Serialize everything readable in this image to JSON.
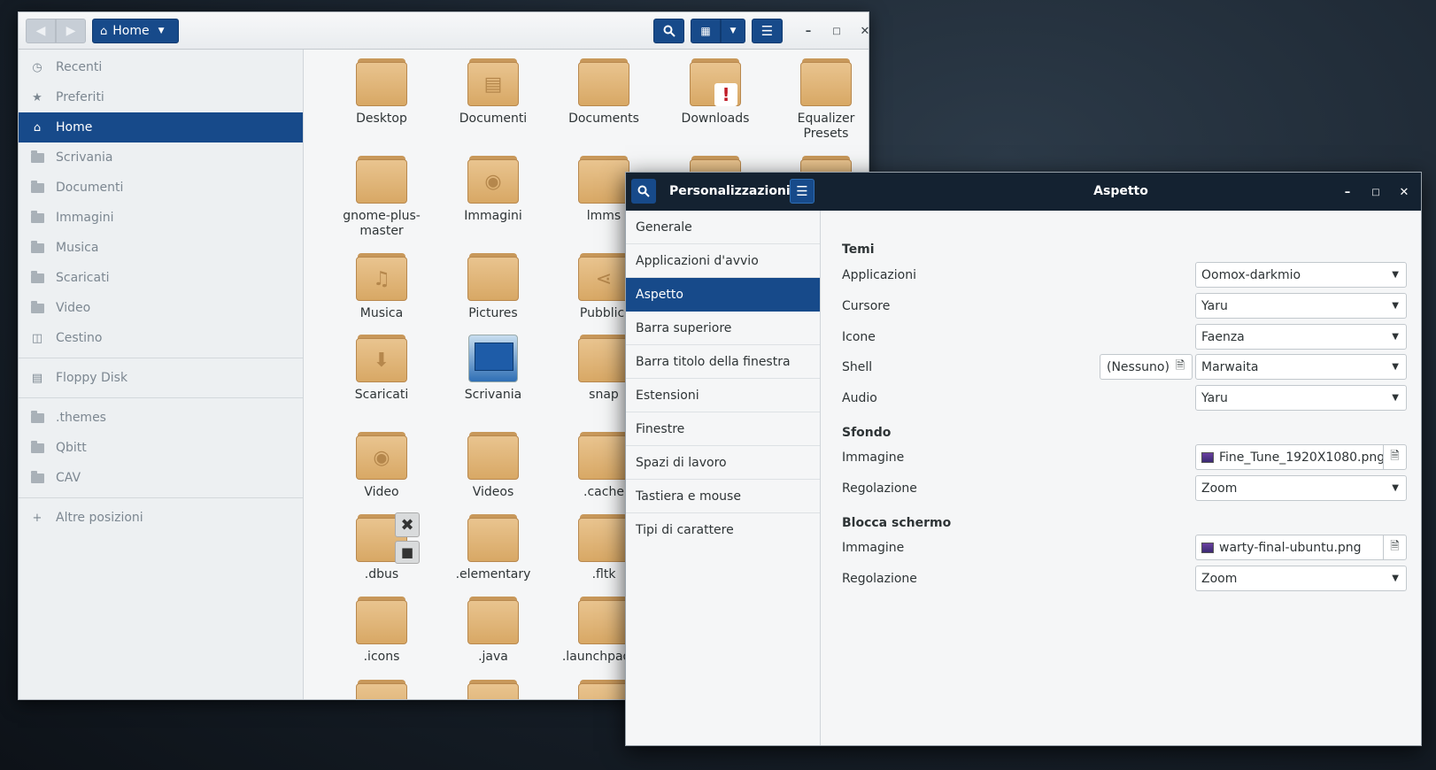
{
  "file_manager": {
    "location": "Home",
    "sidebar": [
      {
        "label": "Recenti",
        "icon": "clock-icon"
      },
      {
        "label": "Preferiti",
        "icon": "star-icon"
      },
      {
        "label": "Home",
        "icon": "home-icon",
        "active": true
      },
      {
        "label": "Scrivania",
        "icon": "folder-icon"
      },
      {
        "label": "Documenti",
        "icon": "folder-icon"
      },
      {
        "label": "Immagini",
        "icon": "folder-icon"
      },
      {
        "label": "Musica",
        "icon": "folder-icon"
      },
      {
        "label": "Scaricati",
        "icon": "folder-icon"
      },
      {
        "label": "Video",
        "icon": "folder-icon"
      },
      {
        "label": "Cestino",
        "icon": "trash-icon"
      },
      {
        "label": "Floppy Disk",
        "icon": "drive-icon"
      },
      {
        "label": ".themes",
        "icon": "folder-icon"
      },
      {
        "label": "Qbitt",
        "icon": "folder-icon"
      },
      {
        "label": "CAV",
        "icon": "folder-icon"
      },
      {
        "label": "Altre posizioni",
        "icon": "plus-icon"
      }
    ],
    "items": [
      {
        "label": "Desktop"
      },
      {
        "label": "Documenti",
        "emblem": "document-icon"
      },
      {
        "label": "Documents"
      },
      {
        "label": "Downloads",
        "badge": "warning-icon"
      },
      {
        "label": "Equalizer Presets"
      },
      {
        "label": "gnome-plus-master"
      },
      {
        "label": "Immagini",
        "emblem": "camera-icon"
      },
      {
        "label": "lmms"
      },
      {
        "label": "Musica",
        "emblem": "music-note-icon"
      },
      {
        "label": "Pictures"
      },
      {
        "label": "Pubblici",
        "emblem": "share-icon"
      },
      {
        "label": "Scaricati",
        "emblem": "download-arrow-icon"
      },
      {
        "label": "Scrivania",
        "special": "desktop-app-icon"
      },
      {
        "label": "snap"
      },
      {
        "label": "Video",
        "emblem": "film-camera-icon"
      },
      {
        "label": "Videos"
      },
      {
        "label": ".cache"
      },
      {
        "label": ".dbus",
        "badge": "no-access-lock-icon"
      },
      {
        "label": ".elementary"
      },
      {
        "label": ".fltk"
      },
      {
        "label": ".icons"
      },
      {
        "label": ".java"
      },
      {
        "label": ".launchpadlib"
      }
    ]
  },
  "tweaks": {
    "sidebar_title": "Personalizzazioni",
    "title": "Aspetto",
    "sidebar": [
      {
        "label": "Generale"
      },
      {
        "label": "Applicazioni d'avvio"
      },
      {
        "label": "Aspetto",
        "active": true
      },
      {
        "label": "Barra superiore"
      },
      {
        "label": "Barra titolo della finestra"
      },
      {
        "label": "Estensioni"
      },
      {
        "label": "Finestre"
      },
      {
        "label": "Spazi di lavoro"
      },
      {
        "label": "Tastiera e mouse"
      },
      {
        "label": "Tipi di carattere"
      }
    ],
    "sections": {
      "themes": {
        "title": "Temi",
        "applications": {
          "label": "Applicazioni",
          "value": "Oomox-darkmio"
        },
        "cursor": {
          "label": "Cursore",
          "value": "Yaru"
        },
        "icons": {
          "label": "Icone",
          "value": "Faenza"
        },
        "shell": {
          "label": "Shell",
          "file": "(Nessuno)",
          "value": "Marwaita"
        },
        "sound": {
          "label": "Audio",
          "value": "Yaru"
        }
      },
      "background": {
        "title": "Sfondo",
        "image": {
          "label": "Immagine",
          "value": "Fine_Tune_1920X1080.png"
        },
        "adjustment": {
          "label": "Regolazione",
          "value": "Zoom"
        }
      },
      "lock_screen": {
        "title": "Blocca schermo",
        "image": {
          "label": "Immagine",
          "value": "warty-final-ubuntu.png"
        },
        "adjustment": {
          "label": "Regolazione",
          "value": "Zoom"
        }
      }
    }
  },
  "colors": {
    "accent": "#174a8a",
    "header_dark": "#142231",
    "folder": "#deb073"
  }
}
